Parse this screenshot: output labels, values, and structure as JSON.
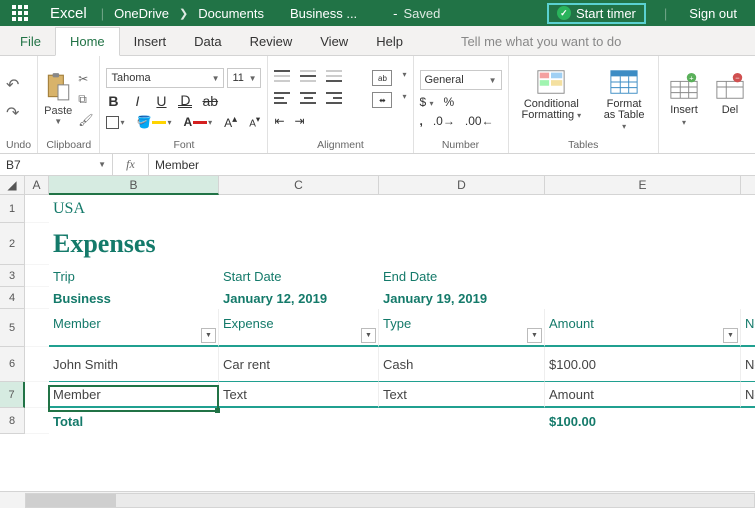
{
  "titlebar": {
    "app": "Excel",
    "loc1": "OneDrive",
    "loc2": "Documents",
    "doc": "Business ...",
    "saved": "Saved",
    "start_timer": "Start timer",
    "signout": "Sign out"
  },
  "tabs": {
    "file": "File",
    "home": "Home",
    "insert": "Insert",
    "data": "Data",
    "review": "Review",
    "view": "View",
    "help": "Help",
    "tell": "Tell me what you want to do"
  },
  "ribbon": {
    "undo": "Undo",
    "clipboard": "Clipboard",
    "paste": "Paste",
    "font_group": "Font",
    "font_name": "Tahoma",
    "font_size": "11",
    "alignment": "Alignment",
    "number": "Number",
    "num_format": "General",
    "tables": "Tables",
    "cond_fmt": "Conditional Formatting",
    "fmt_table": "Format as Table",
    "insert": "Insert",
    "delete": "Del"
  },
  "namebox": "B7",
  "formula": "Member",
  "cols": {
    "A": "A",
    "B": "B",
    "C": "C",
    "D": "D",
    "E": "E"
  },
  "rows": {
    "1": "1",
    "2": "2",
    "3": "3",
    "4": "4",
    "5": "5",
    "6": "6",
    "7": "7",
    "8": "8"
  },
  "sheet": {
    "usa": "USA",
    "expenses": "Expenses",
    "r3": {
      "b": "Trip",
      "c": "Start Date",
      "d": "End Date"
    },
    "r4": {
      "b": "Business",
      "c": "January 12, 2019",
      "d": "January 19, 2019"
    },
    "hdr": {
      "b": "Member",
      "c": "Expense",
      "d": "Type",
      "e": "Amount",
      "f": "Notes"
    },
    "r6": {
      "b": "John Smith",
      "c": "Car rent",
      "d": "Cash",
      "e": "$100.00",
      "f": "Note"
    },
    "r7": {
      "b": "Member",
      "c": "Text",
      "d": "Text",
      "e": "Amount",
      "f": "Note"
    },
    "r8": {
      "b": "Total",
      "e": "$100.00"
    }
  }
}
